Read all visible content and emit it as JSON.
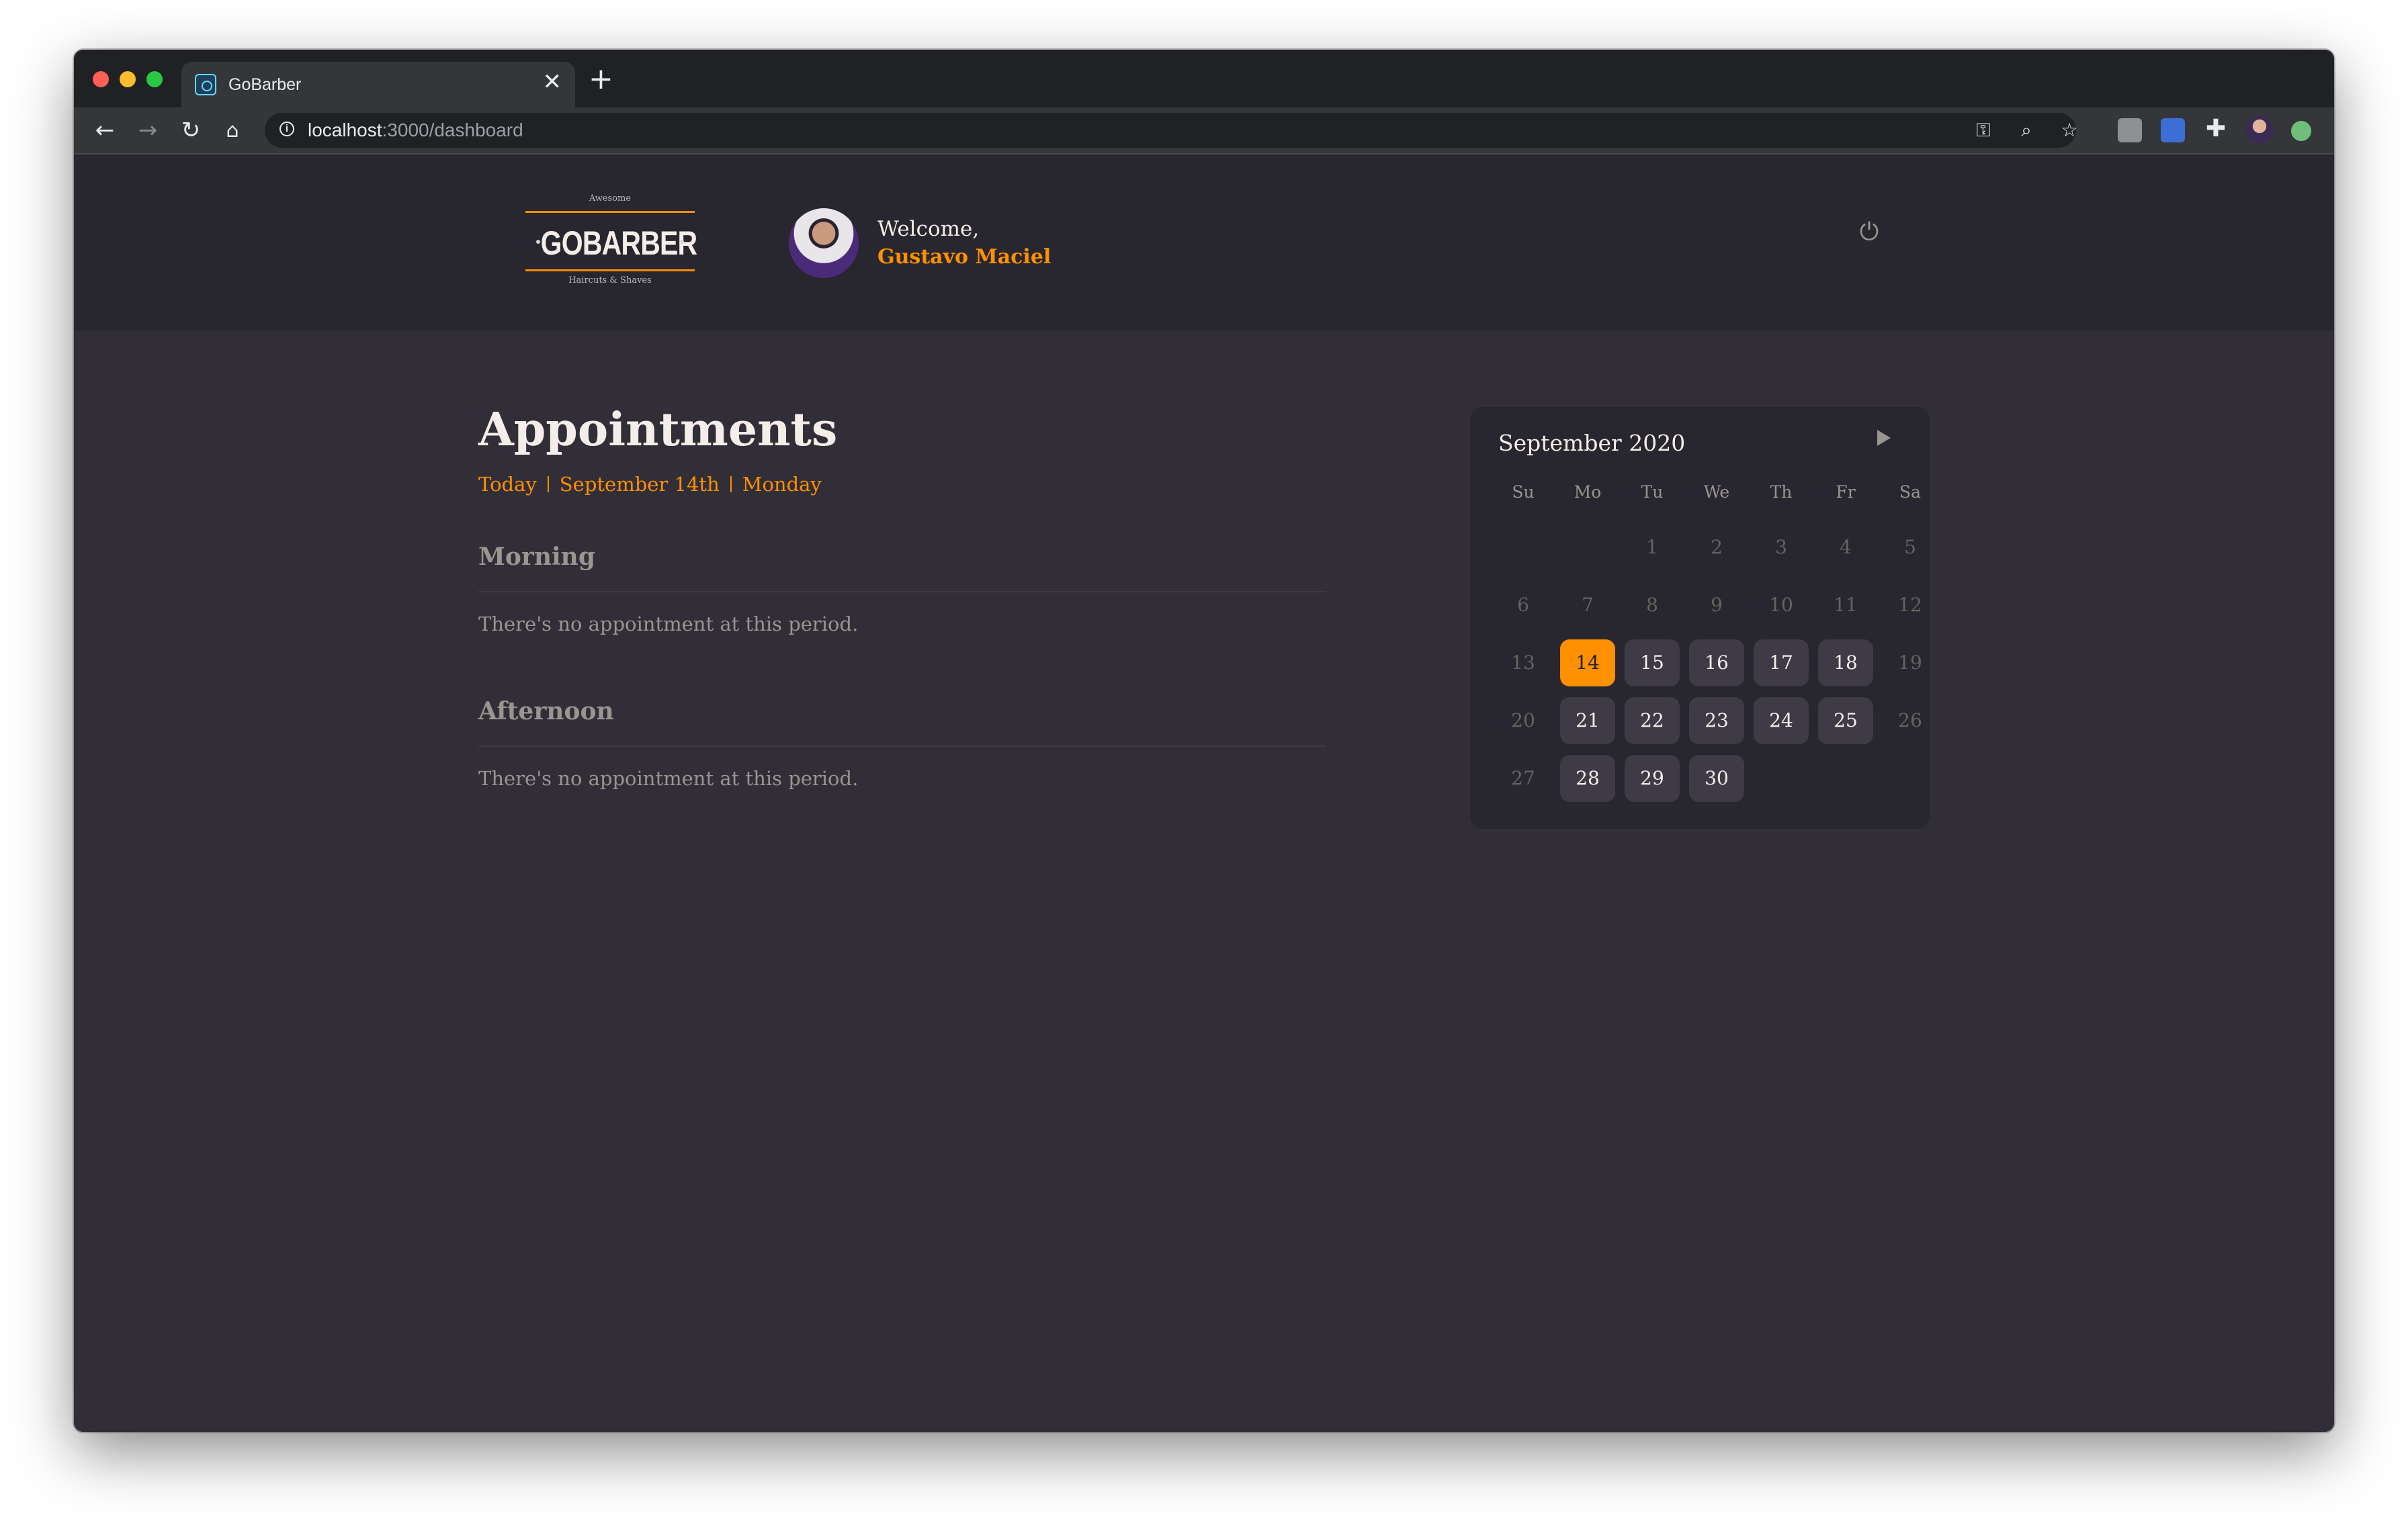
{
  "browser": {
    "tab_title": "GoBarber",
    "tab_close": "✕",
    "new_tab": "+",
    "url_host": "localhost",
    "url_path": ":3000/dashboard"
  },
  "header": {
    "logo": {
      "top_text": "Awesome",
      "main_text": "GOBARBER",
      "bottom_text": "Haircuts & Shaves"
    },
    "welcome_label": "Welcome,",
    "user_name": "Gustavo Maciel"
  },
  "schedule": {
    "title": "Appointments",
    "today_label": "Today",
    "date_label": "September 14th",
    "weekday_label": "Monday",
    "sections": [
      {
        "title": "Morning",
        "empty_text": "There's no appointment at this period."
      },
      {
        "title": "Afternoon",
        "empty_text": "There's no appointment at this period."
      }
    ]
  },
  "calendar": {
    "caption": "September 2020",
    "weekdays": [
      "Su",
      "Mo",
      "Tu",
      "We",
      "Th",
      "Fr",
      "Sa"
    ],
    "selected_day": "14",
    "weeks": [
      [
        "",
        "",
        "1",
        "2",
        "3",
        "4",
        "5"
      ],
      [
        "6",
        "7",
        "8",
        "9",
        "10",
        "11",
        "12"
      ],
      [
        "13",
        "14",
        "15",
        "16",
        "17",
        "18",
        "19"
      ],
      [
        "20",
        "21",
        "22",
        "23",
        "24",
        "25",
        "26"
      ],
      [
        "27",
        "28",
        "29",
        "30",
        "",
        "",
        ""
      ]
    ],
    "available_days": [
      "14",
      "15",
      "16",
      "17",
      "18",
      "21",
      "22",
      "23",
      "24",
      "25",
      "28",
      "29",
      "30"
    ]
  },
  "colors": {
    "accent": "#ff9000",
    "background": "#312e38",
    "header": "#28262e",
    "text": "#f4ede8",
    "muted": "#999591"
  }
}
